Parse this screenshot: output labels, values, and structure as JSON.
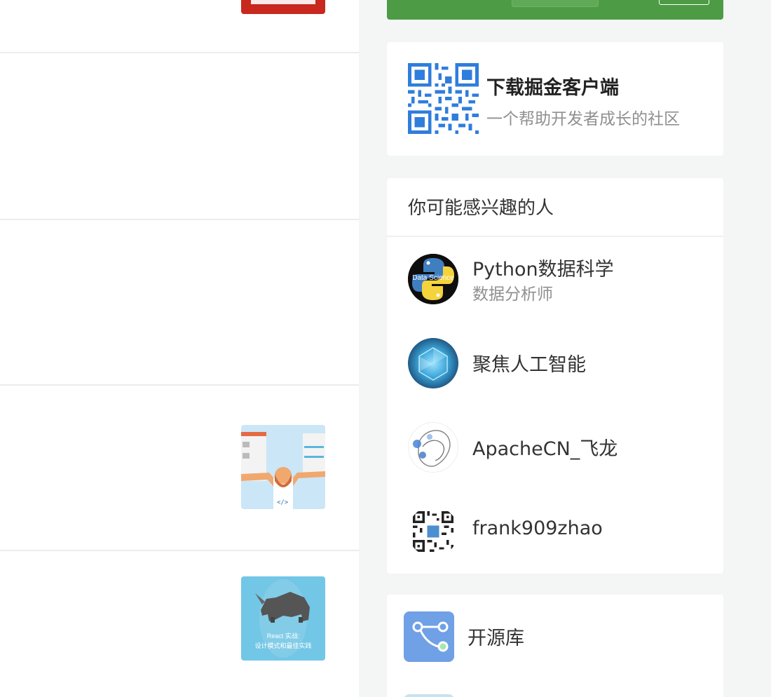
{
  "download_card": {
    "title": "下载掘金客户端",
    "subtitle": "一个帮助开发者成长的社区"
  },
  "people_card": {
    "header": "你可能感兴趣的人",
    "people": [
      {
        "name": "Python数据科学",
        "title": "数据分析师",
        "avatar_text": "Data Science"
      },
      {
        "name": "聚焦人工智能",
        "title": ""
      },
      {
        "name": "ApacheCN_飞龙",
        "title": ""
      },
      {
        "name": "frank909zhao",
        "title": ""
      }
    ]
  },
  "opensource_card": {
    "label": "开源库"
  },
  "feed": {
    "thumb_react_caption_1": "React 实战:",
    "thumb_react_caption_2": "设计模式和最佳实践"
  },
  "colors": {
    "banner_green": "#4e9b46",
    "qr_blue": "#2f7ddc",
    "repo_blue": "#70a0e6"
  }
}
